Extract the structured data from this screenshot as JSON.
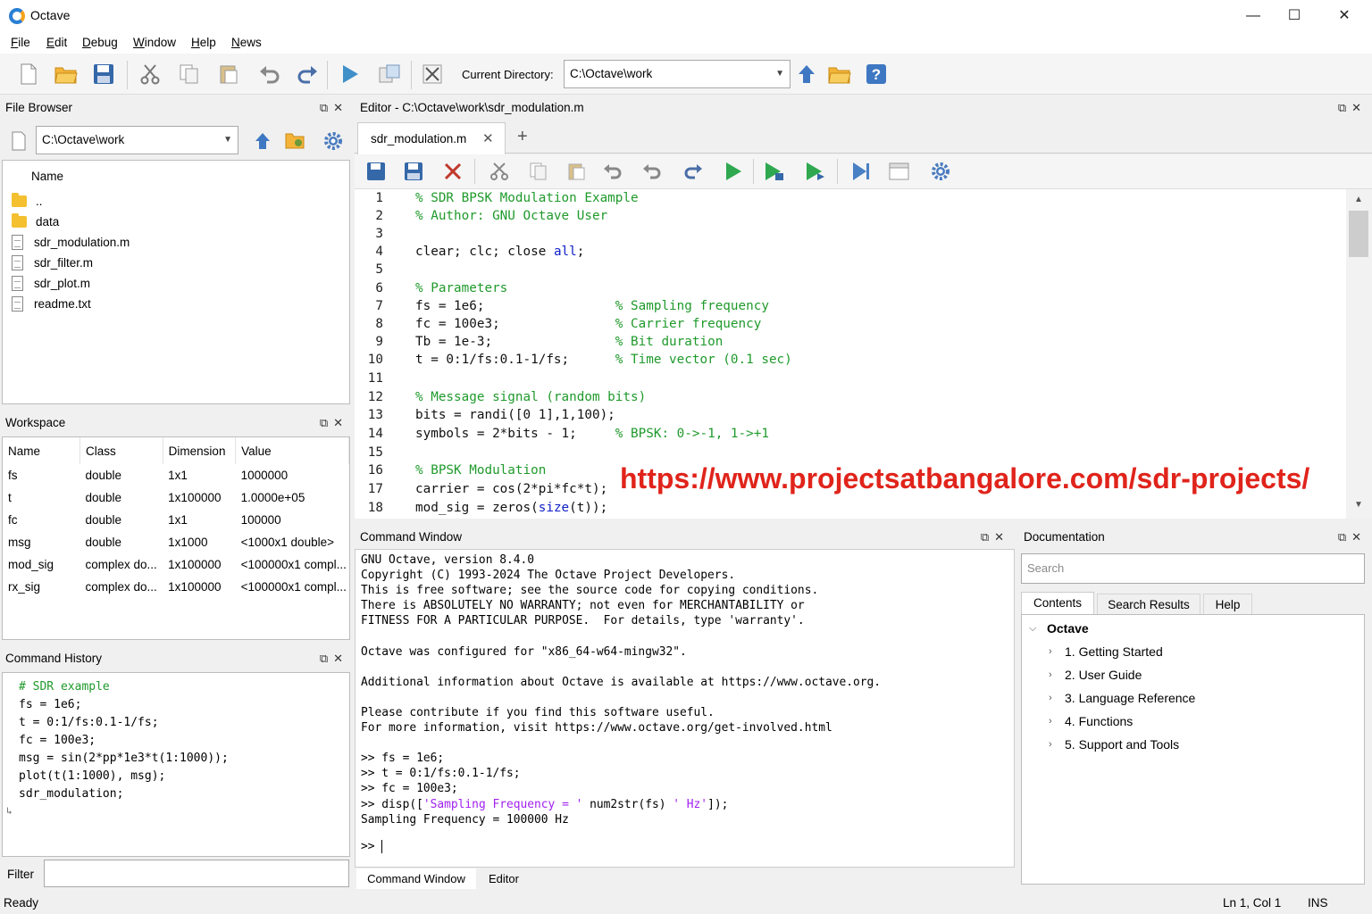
{
  "window": {
    "title": "Octave",
    "minimize": "—",
    "maximize": "☐",
    "close": "✕"
  },
  "menu": {
    "file": {
      "u": "F",
      "rest": "ile"
    },
    "edit": {
      "u": "E",
      "rest": "dit"
    },
    "debug": {
      "u": "D",
      "rest": "ebug"
    },
    "window": {
      "u": "W",
      "rest": "indow"
    },
    "help": {
      "u": "H",
      "rest": "elp"
    },
    "news": {
      "u": "N",
      "rest": "ews"
    }
  },
  "toolbar": {
    "current_directory_label": "Current Directory:",
    "current_directory": "C:\\Octave\\work"
  },
  "file_browser": {
    "title": "File Browser",
    "path": "C:\\Octave\\work",
    "column": "Name",
    "items": [
      {
        "name": "..",
        "type": "folder"
      },
      {
        "name": "data",
        "type": "folder"
      },
      {
        "name": "sdr_modulation.m",
        "type": "file"
      },
      {
        "name": "sdr_filter.m",
        "type": "file"
      },
      {
        "name": "sdr_plot.m",
        "type": "file"
      },
      {
        "name": "readme.txt",
        "type": "file"
      }
    ]
  },
  "workspace": {
    "title": "Workspace",
    "columns": [
      "Name",
      "Class",
      "Dimension",
      "Value"
    ],
    "rows": [
      [
        "fs",
        "double",
        "1x1",
        "1000000"
      ],
      [
        "t",
        "double",
        "1x100000",
        "1.0000e+05"
      ],
      [
        "fc",
        "double",
        "1x1",
        "100000"
      ],
      [
        "msg",
        "double",
        "1x1000",
        "<1000x1 double>"
      ],
      [
        "mod_sig",
        "complex do...",
        "1x100000",
        "<100000x1 compl..."
      ],
      [
        "rx_sig",
        "complex do...",
        "1x100000",
        "<100000x1 compl..."
      ]
    ]
  },
  "command_history": {
    "title": "Command History",
    "lines": [
      "# SDR example",
      "fs = 1e6;",
      "t = 0:1/fs:0.1-1/fs;",
      "fc = 100e3;",
      "msg = sin(2*pp*1e3*t(1:1000));",
      "plot(t(1:1000), msg);",
      "sdr_modulation;"
    ],
    "filter_label": "Filter"
  },
  "editor": {
    "title": "Editor - C:\\Octave\\work\\sdr_modulation.m",
    "tab": "sdr_modulation.m",
    "lines": [
      {
        "n": "1",
        "segs": [
          {
            "t": "% SDR BPSK Modulation Example",
            "c": "cm"
          }
        ]
      },
      {
        "n": "2",
        "segs": [
          {
            "t": "% Author: GNU Octave User",
            "c": "cm"
          }
        ]
      },
      {
        "n": "3",
        "segs": []
      },
      {
        "n": "4",
        "segs": [
          {
            "t": "clear; clc; close ",
            "c": ""
          },
          {
            "t": "all",
            "c": "kw"
          },
          {
            "t": ";",
            "c": ""
          }
        ]
      },
      {
        "n": "5",
        "segs": []
      },
      {
        "n": "6",
        "segs": [
          {
            "t": "% Parameters",
            "c": "cm"
          }
        ]
      },
      {
        "n": "7",
        "segs": [
          {
            "t": "fs = 1e6;                 ",
            "c": ""
          },
          {
            "t": "% Sampling frequency",
            "c": "cm"
          }
        ]
      },
      {
        "n": "8",
        "segs": [
          {
            "t": "fc = 100e3;               ",
            "c": ""
          },
          {
            "t": "% Carrier frequency",
            "c": "cm"
          }
        ]
      },
      {
        "n": "9",
        "segs": [
          {
            "t": "Tb = 1e-3;                ",
            "c": ""
          },
          {
            "t": "% Bit duration",
            "c": "cm"
          }
        ]
      },
      {
        "n": "10",
        "segs": [
          {
            "t": "t = 0:1/fs:0.1-1/fs;      ",
            "c": ""
          },
          {
            "t": "% Time vector (0.1 sec)",
            "c": "cm"
          }
        ]
      },
      {
        "n": "11",
        "segs": []
      },
      {
        "n": "12",
        "segs": [
          {
            "t": "% Message signal (random bits)",
            "c": "cm"
          }
        ]
      },
      {
        "n": "13",
        "segs": [
          {
            "t": "bits = randi([0 1],1,100);",
            "c": ""
          }
        ]
      },
      {
        "n": "14",
        "segs": [
          {
            "t": "symbols = 2*bits - 1;     ",
            "c": ""
          },
          {
            "t": "% BPSK: 0->-1, 1->+1",
            "c": "cm"
          }
        ]
      },
      {
        "n": "15",
        "segs": []
      },
      {
        "n": "16",
        "segs": [
          {
            "t": "% BPSK Modulation",
            "c": "cm"
          }
        ]
      },
      {
        "n": "17",
        "segs": [
          {
            "t": "carrier = cos(2*pi*fc*t);",
            "c": ""
          }
        ]
      },
      {
        "n": "18",
        "segs": [
          {
            "t": "mod_sig = zeros(",
            "c": ""
          },
          {
            "t": "size",
            "c": "kw"
          },
          {
            "t": "(t));",
            "c": ""
          }
        ]
      }
    ],
    "watermark": "https://www.projectsatbangalore.com/sdr-projects/"
  },
  "command_window": {
    "title": "Command Window",
    "lines": [
      "GNU Octave, version 8.4.0",
      "Copyright (C) 1993-2024 The Octave Project Developers.",
      "This is free software; see the source code for copying conditions.",
      "There is ABSOLUTELY NO WARRANTY; not even for MERCHANTABILITY or",
      "FITNESS FOR A PARTICULAR PURPOSE.  For details, type 'warranty'.",
      "",
      "Octave was configured for \"x86_64-w64-mingw32\".",
      "",
      "Additional information about Octave is available at https://www.octave.org.",
      "",
      "Please contribute if you find this software useful.",
      "For more information, visit https://www.octave.org/get-involved.html",
      "",
      ">> fs = 1e6;",
      ">> t = 0:1/fs:0.1-1/fs;",
      ">> fc = 100e3;"
    ],
    "disp_prefix": ">> disp([",
    "disp_str1": "'Sampling Frequency = '",
    "disp_mid": " num2str(fs) ",
    "disp_str2": "' Hz'",
    "disp_suffix": "]);",
    "output": "Sampling Frequency = 100000 Hz",
    "prompt": ">> ",
    "tabs": [
      "Command Window",
      "Editor"
    ]
  },
  "documentation": {
    "title": "Documentation",
    "search_placeholder": "Search",
    "tabs": [
      "Contents",
      "Search Results",
      "Help"
    ],
    "root": "Octave",
    "items": [
      "1. Getting Started",
      "2. User Guide",
      "3. Language Reference",
      "4. Functions",
      "5. Support and Tools"
    ]
  },
  "status": {
    "ready": "Ready",
    "position": "Ln 1, Col 1",
    "mode": "INS"
  }
}
